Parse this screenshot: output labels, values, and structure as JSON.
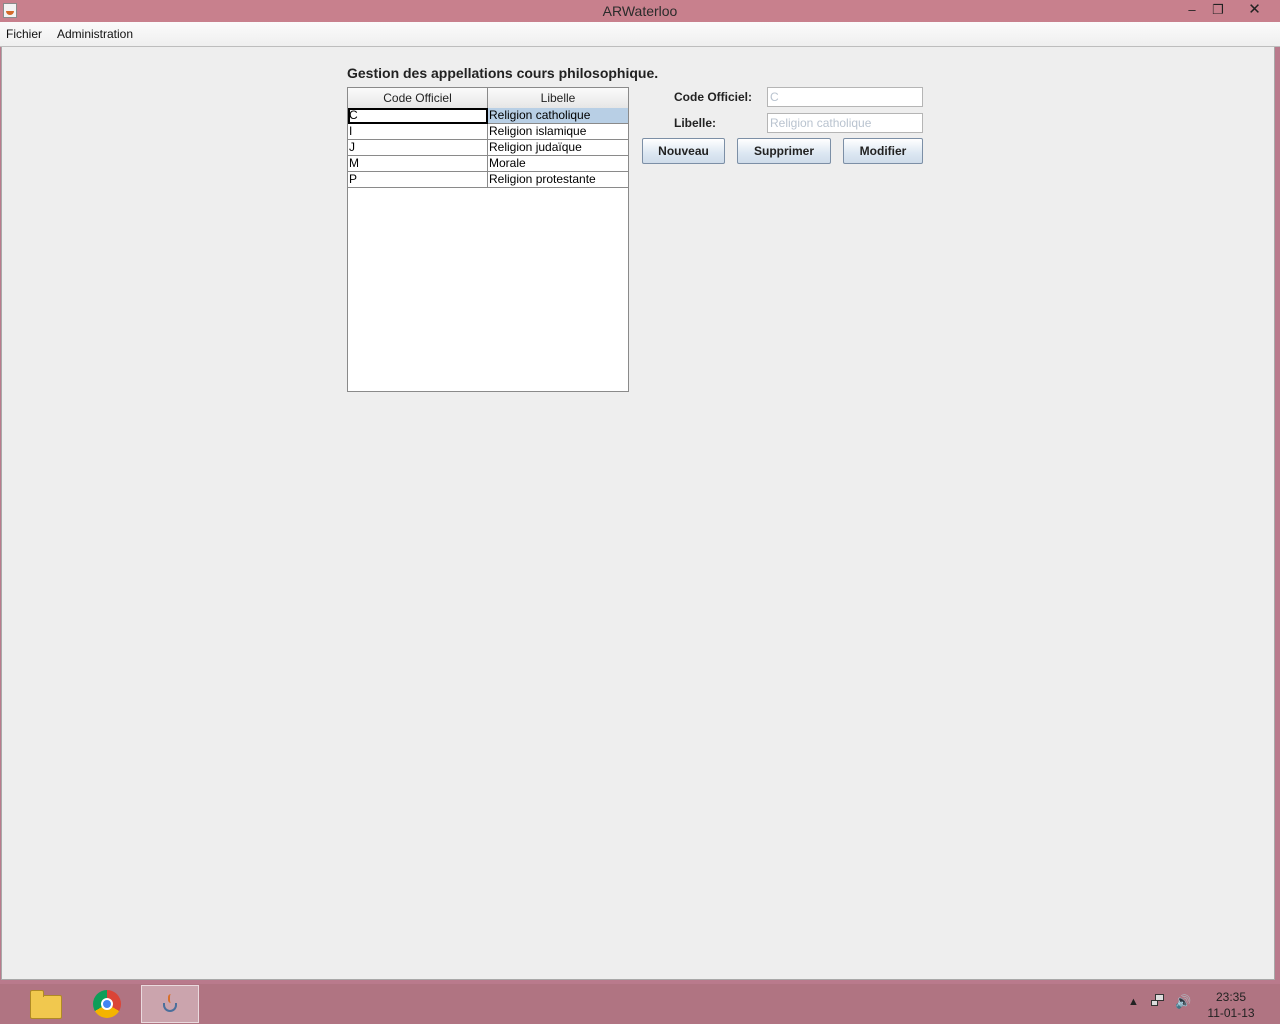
{
  "window": {
    "title": "ARWaterloo",
    "minimize": "–",
    "maximize": "❐",
    "close": "✕"
  },
  "menubar": [
    "Fichier",
    "Administration"
  ],
  "page": {
    "title": "Gestion des appellations cours philosophique."
  },
  "table": {
    "columns": [
      "Code Officiel",
      "Libelle"
    ],
    "rows": [
      {
        "code": "C",
        "libelle": "Religion catholique",
        "selected": true
      },
      {
        "code": "I",
        "libelle": "Religion islamique"
      },
      {
        "code": "J",
        "libelle": "Religion judaïque"
      },
      {
        "code": "M",
        "libelle": "Morale"
      },
      {
        "code": "P",
        "libelle": "Religion protestante"
      }
    ]
  },
  "form": {
    "code_label": "Code Officiel:",
    "code_value": "C",
    "libelle_label": "Libelle:",
    "libelle_value": "Religion catholique",
    "buttons": {
      "new": "Nouveau",
      "delete": "Supprimer",
      "modify": "Modifier"
    }
  },
  "taskbar": {
    "apps": [
      "folder-icon",
      "chrome-icon",
      "java-icon"
    ],
    "clock_time": "23:35",
    "clock_date": "11-01-13",
    "tray_icons": [
      "show-hidden-icon",
      "network-icon",
      "volume-icon"
    ]
  },
  "colors": {
    "titlebar": "#c8808d",
    "selection": "#b8cfe5",
    "taskbar": "#b07482"
  }
}
